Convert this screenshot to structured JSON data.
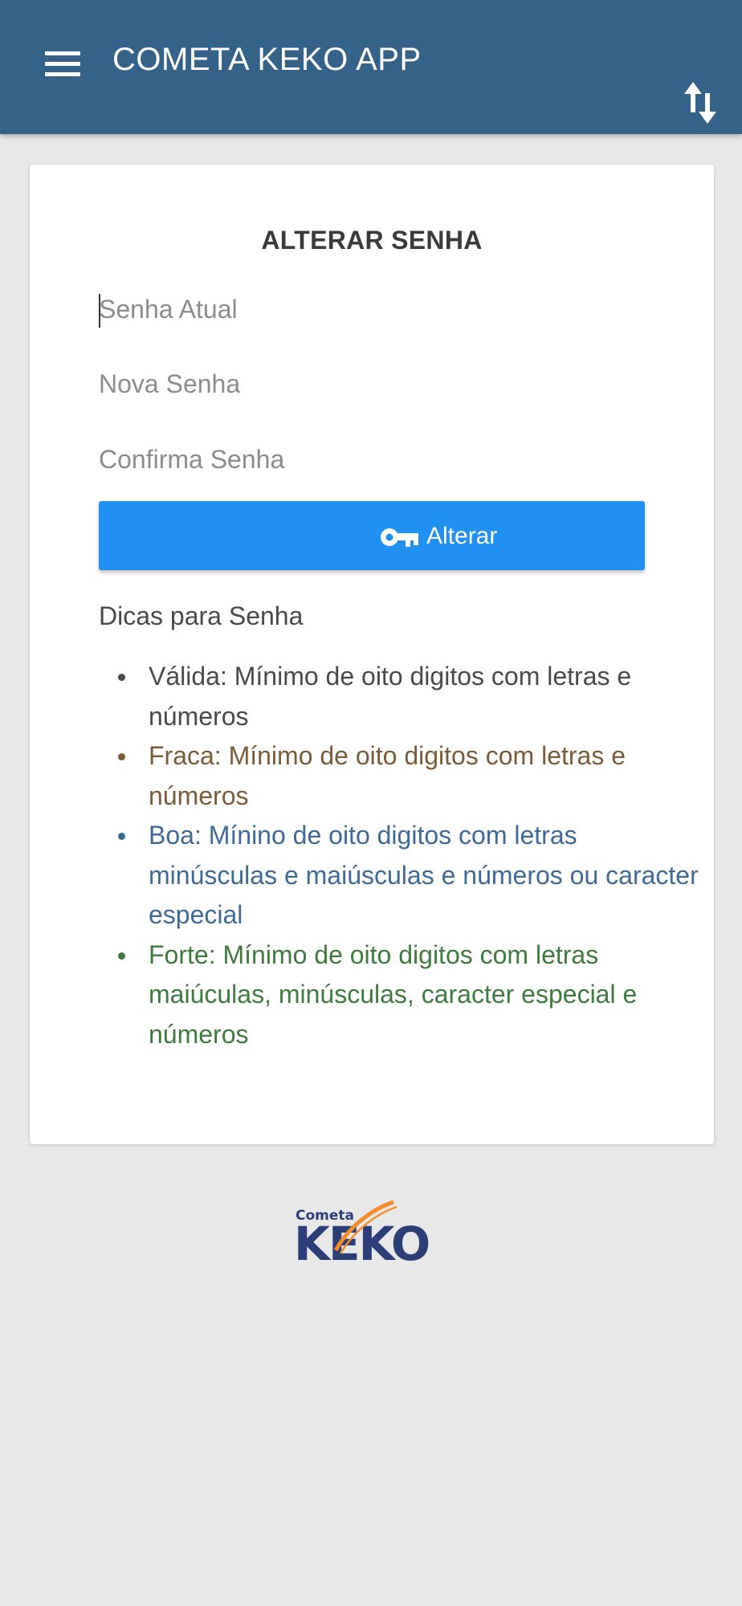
{
  "app": {
    "title": "COMETA KEKO APP",
    "header_color": "#356289"
  },
  "header": {
    "menu_icon": "hamburger-menu-icon",
    "sort_icon": "swap-vertical-icon"
  },
  "form": {
    "title": "ALTERAR SENHA",
    "fields": [
      {
        "placeholder": "Senha Atual",
        "value": ""
      },
      {
        "placeholder": "Nova Senha",
        "value": ""
      },
      {
        "placeholder": "Confirma Senha",
        "value": ""
      }
    ],
    "submit": {
      "label": "Alterar",
      "icon": "key-icon",
      "color": "#2190f3"
    }
  },
  "tips": {
    "title": "Dicas para Senha",
    "items": [
      {
        "text": "Válida: Mínimo de oito digitos com letras e números",
        "color": "#4a4a4a"
      },
      {
        "text": "Fraca: Mínimo de oito digitos com letras e números",
        "color": "#7a5c38"
      },
      {
        "text": "Boa: Mínino de oito digitos com letras minúsculas e maiúsculas e números ou caracter especial",
        "color": "#3f6a96"
      },
      {
        "text": "Forte: Mínimo de oito digitos com letras maiúculas, minúsculas, caracter especial e números",
        "color": "#3f7a3f"
      }
    ]
  },
  "footer": {
    "logo_small_text": "Cometa",
    "logo_text": "KEKO"
  }
}
